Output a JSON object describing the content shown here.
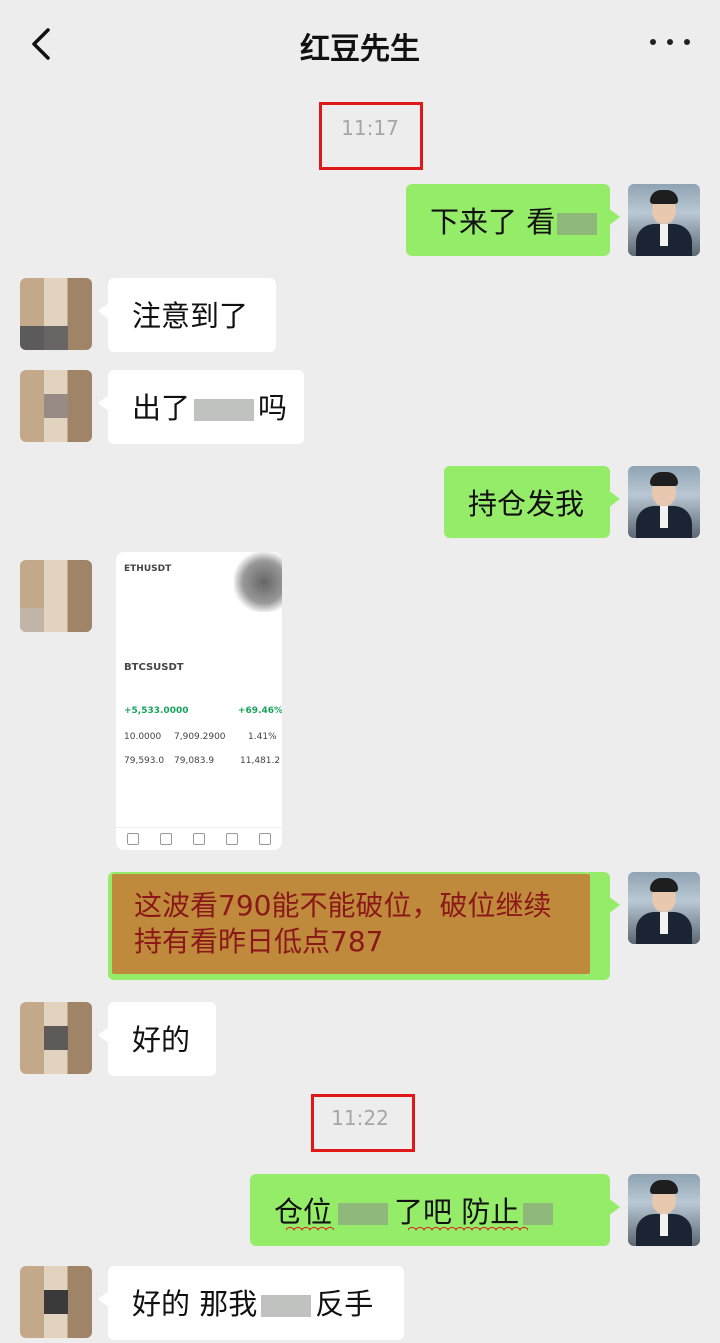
{
  "header": {
    "title": "红豆先生",
    "back_icon": "chevron-left-icon",
    "more_icon": "more-dots-icon"
  },
  "timestamps": [
    "11:17",
    "11:22"
  ],
  "messages": [
    {
      "side": "me",
      "text": "下来了 看"
    },
    {
      "side": "other",
      "text": "注意到了"
    },
    {
      "side": "other",
      "text_start": "出了",
      "text_end": "吗"
    },
    {
      "side": "me",
      "text": "持仓发我"
    },
    {
      "side": "other",
      "type": "image"
    },
    {
      "side": "me",
      "text_line1": "这波看790能不能破位，破位继续",
      "text_line2": "持有看昨日低点787"
    },
    {
      "side": "other",
      "text": "好的"
    },
    {
      "side": "me",
      "text_start": "仓位",
      "text_mid": "了吧 防止",
      "text_end": ""
    },
    {
      "side": "other",
      "text_start": "好的 那我",
      "text_end": "反手"
    }
  ],
  "screenshot": {
    "symbol_top": "ETHUSDT",
    "symbol": "BTCSUSDT",
    "pnl": "+5,533.0000",
    "roe": "+69.46%",
    "value1": "10.0000",
    "value2": "7,909.2900",
    "value3": "1.41%",
    "value4": "79,593.0",
    "value5": "79,083.9",
    "value6": "11,481.2"
  },
  "colors": {
    "bg": "#ededed",
    "me_bubble": "#95ec69",
    "other_bubble": "#ffffff",
    "highlight": "#c08a3c",
    "highlight_text": "#8b1818",
    "annotation_red": "#e01818"
  }
}
